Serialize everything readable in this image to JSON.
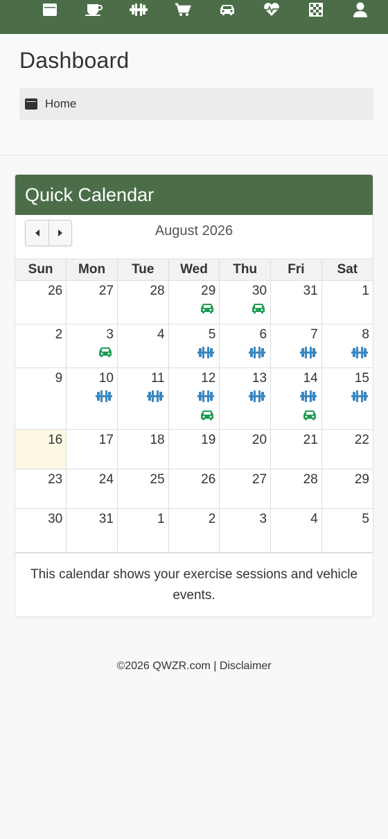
{
  "nav": {
    "items": [
      {
        "name": "calendar-nav-button",
        "icon": "calendar-icon"
      },
      {
        "name": "coffee-nav-button",
        "icon": "coffee-cup-icon"
      },
      {
        "name": "exercise-nav-button",
        "icon": "dumbbell-icon"
      },
      {
        "name": "shopping-nav-button",
        "icon": "shopping-cart-icon"
      },
      {
        "name": "vehicle-nav-button",
        "icon": "car-icon"
      },
      {
        "name": "health-nav-button",
        "icon": "heartbeat-icon"
      },
      {
        "name": "checklist-nav-button",
        "icon": "checkerboard-icon"
      },
      {
        "name": "account-nav-button",
        "icon": "user-icon"
      }
    ],
    "color": "#4b6e48"
  },
  "page": {
    "title": "Dashboard",
    "breadcrumb": {
      "icon": "calendar-icon",
      "label": "Home"
    }
  },
  "calendar": {
    "panel_title": "Quick Calendar",
    "month_label": "August 2026",
    "weekdays": [
      "Sun",
      "Mon",
      "Tue",
      "Wed",
      "Thu",
      "Fri",
      "Sat"
    ],
    "weeks": [
      [
        {
          "d": "26",
          "other": true
        },
        {
          "d": "27",
          "other": true
        },
        {
          "d": "28",
          "other": true
        },
        {
          "d": "29",
          "other": true,
          "events": [
            "car"
          ]
        },
        {
          "d": "30",
          "other": true,
          "events": [
            "car"
          ]
        },
        {
          "d": "31",
          "other": true
        },
        {
          "d": "1"
        }
      ],
      [
        {
          "d": "2"
        },
        {
          "d": "3",
          "events": [
            "car"
          ]
        },
        {
          "d": "4"
        },
        {
          "d": "5",
          "events": [
            "exercise"
          ]
        },
        {
          "d": "6",
          "events": [
            "exercise"
          ]
        },
        {
          "d": "7",
          "events": [
            "exercise"
          ]
        },
        {
          "d": "8",
          "events": [
            "exercise"
          ]
        }
      ],
      [
        {
          "d": "9"
        },
        {
          "d": "10",
          "events": [
            "exercise"
          ]
        },
        {
          "d": "11",
          "events": [
            "exercise"
          ]
        },
        {
          "d": "12",
          "events": [
            "exercise",
            "car"
          ]
        },
        {
          "d": "13",
          "events": [
            "exercise"
          ]
        },
        {
          "d": "14",
          "events": [
            "exercise",
            "car"
          ]
        },
        {
          "d": "15",
          "events": [
            "exercise"
          ]
        }
      ],
      [
        {
          "d": "16",
          "today": true
        },
        {
          "d": "17"
        },
        {
          "d": "18"
        },
        {
          "d": "19"
        },
        {
          "d": "20"
        },
        {
          "d": "21"
        },
        {
          "d": "22"
        }
      ],
      [
        {
          "d": "23"
        },
        {
          "d": "24"
        },
        {
          "d": "25"
        },
        {
          "d": "26"
        },
        {
          "d": "27"
        },
        {
          "d": "28"
        },
        {
          "d": "29"
        }
      ],
      [
        {
          "d": "30"
        },
        {
          "d": "31"
        },
        {
          "d": "1",
          "other": true
        },
        {
          "d": "2",
          "other": true
        },
        {
          "d": "3",
          "other": true
        },
        {
          "d": "4",
          "other": true
        },
        {
          "d": "5",
          "other": true
        }
      ]
    ],
    "event_colors": {
      "exercise": "#3a87c0",
      "car": "#1f9d55"
    },
    "event_icons": {
      "exercise": "dumbbell-icon",
      "car": "car-icon"
    },
    "caption": "This calendar shows your exercise sessions and vehicle events."
  },
  "footer": {
    "copyright": "©2026 QWZR.com",
    "separator": "|",
    "disclaimer": "Disclaimer"
  }
}
